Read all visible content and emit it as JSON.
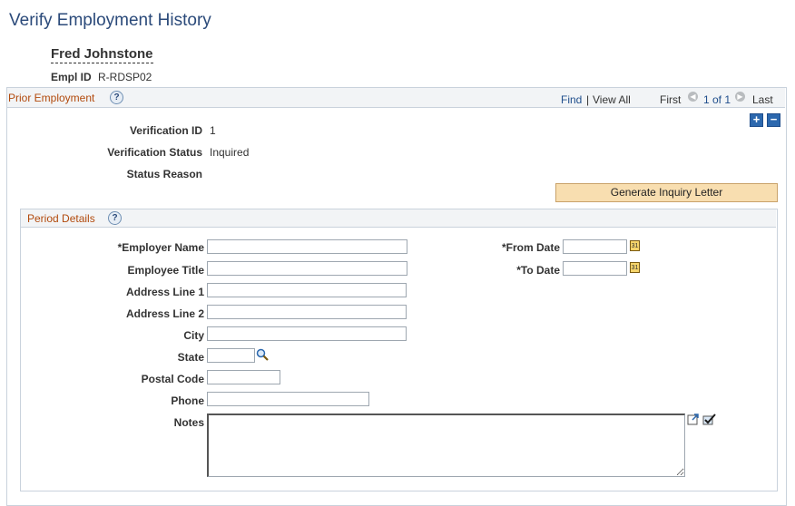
{
  "page": {
    "title": "Verify Employment History"
  },
  "employee": {
    "name": "Fred Johnstone",
    "emplid_label": "Empl ID",
    "emplid": "R-RDSP02"
  },
  "prior": {
    "title": "Prior Employment",
    "nav": {
      "find": "Find",
      "sep": "|",
      "view_all": "View All",
      "first": "First",
      "count": "1 of 1",
      "last": "Last"
    },
    "fields": {
      "verification_id_label": "Verification ID",
      "verification_id": "1",
      "verification_status_label": "Verification Status",
      "verification_status": "Inquired",
      "status_reason_label": "Status Reason"
    },
    "generate_button": "Generate Inquiry Letter"
  },
  "period": {
    "title": "Period Details",
    "labels": {
      "employer_name": "*Employer Name",
      "employee_title": "Employee Title",
      "address1": "Address Line 1",
      "address2": "Address Line 2",
      "city": "City",
      "state": "State",
      "postal": "Postal Code",
      "phone": "Phone",
      "notes": "Notes",
      "from_date": "*From Date",
      "to_date": "*To Date"
    },
    "calendar_icon_text": "31"
  },
  "icons": {
    "help": "help-icon",
    "prev": "prev-arrow-icon",
    "next": "next-arrow-icon",
    "add": "add-row-icon",
    "delete": "delete-row-icon",
    "calendar": "calendar-icon",
    "lookup": "lookup-icon",
    "expand": "expand-icon",
    "spellcheck": "spellcheck-icon"
  },
  "colors": {
    "title": "#2b4a7a",
    "section_title": "#b24a0d",
    "button_bg": "#f8deb0",
    "link": "#1f4e8c"
  }
}
